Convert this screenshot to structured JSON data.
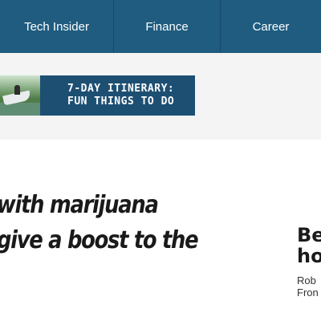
{
  "nav": {
    "items": [
      {
        "label": "Tech Insider"
      },
      {
        "label": "Finance"
      },
      {
        "label": "Career"
      }
    ]
  },
  "ad": {
    "line1": "7-DAY ITINERARY:",
    "line2": "FUN THINGS TO DO"
  },
  "article": {
    "headline_line1": "with marijuana",
    "headline_line2": "give a boost to the"
  },
  "side": {
    "title_line1": "Be",
    "title_line2": "ho",
    "byline_line1": "Rob",
    "byline_line2": "Fron"
  },
  "colors": {
    "nav_bg": "#1f5c7f",
    "ad_bg": "#1d4f73",
    "band_bg": "#f4f4f4"
  }
}
